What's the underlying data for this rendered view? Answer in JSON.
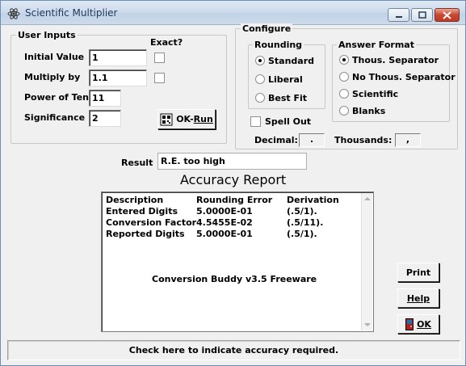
{
  "window": {
    "title": "Scientific Multiplier"
  },
  "user_inputs": {
    "legend": "User Inputs",
    "exact_label": "Exact?",
    "initial_value_label": "Initial Value",
    "initial_value": "1",
    "multiply_by_label": "Multiply by",
    "multiply_by": "1.1",
    "power_of_ten_label": "Power of Ten",
    "power_of_ten": "11",
    "significance_label": "Significance",
    "significance": "2",
    "ok_run_label": "OK-",
    "ok_run_underlined": "Run"
  },
  "configure": {
    "legend": "Configure",
    "rounding": {
      "legend": "Rounding",
      "options": [
        "Standard",
        "Liberal",
        "Best Fit"
      ],
      "selected": "Standard"
    },
    "answer_format": {
      "legend": "Answer Format",
      "options": [
        "Thous. Separator",
        "No Thous. Separator",
        "Scientific",
        "Blanks"
      ],
      "selected": "Thous. Separator"
    },
    "spell_out_label": "Spell Out",
    "decimal_label": "Decimal:",
    "decimal_value": ".",
    "thousands_label": "Thousands:",
    "thousands_value": ","
  },
  "result": {
    "label": "Result",
    "value": "R.E. too high"
  },
  "report": {
    "title": "Accuracy Report",
    "headers": [
      "Description",
      "Rounding Error",
      "Derivation"
    ],
    "rows": [
      [
        "Entered Digits",
        "5.0000E-01",
        "(.5/1)."
      ],
      [
        "Conversion Factor",
        "4.5455E-02",
        "(.5/11)."
      ],
      [
        "Reported Digits",
        "5.0000E-01",
        "(.5/1)."
      ]
    ],
    "footer": "Conversion Buddy v3.5 Freeware"
  },
  "buttons": {
    "print": "Print",
    "help": "Help",
    "ok": "OK"
  },
  "status_bar": "Check here to indicate accuracy required."
}
